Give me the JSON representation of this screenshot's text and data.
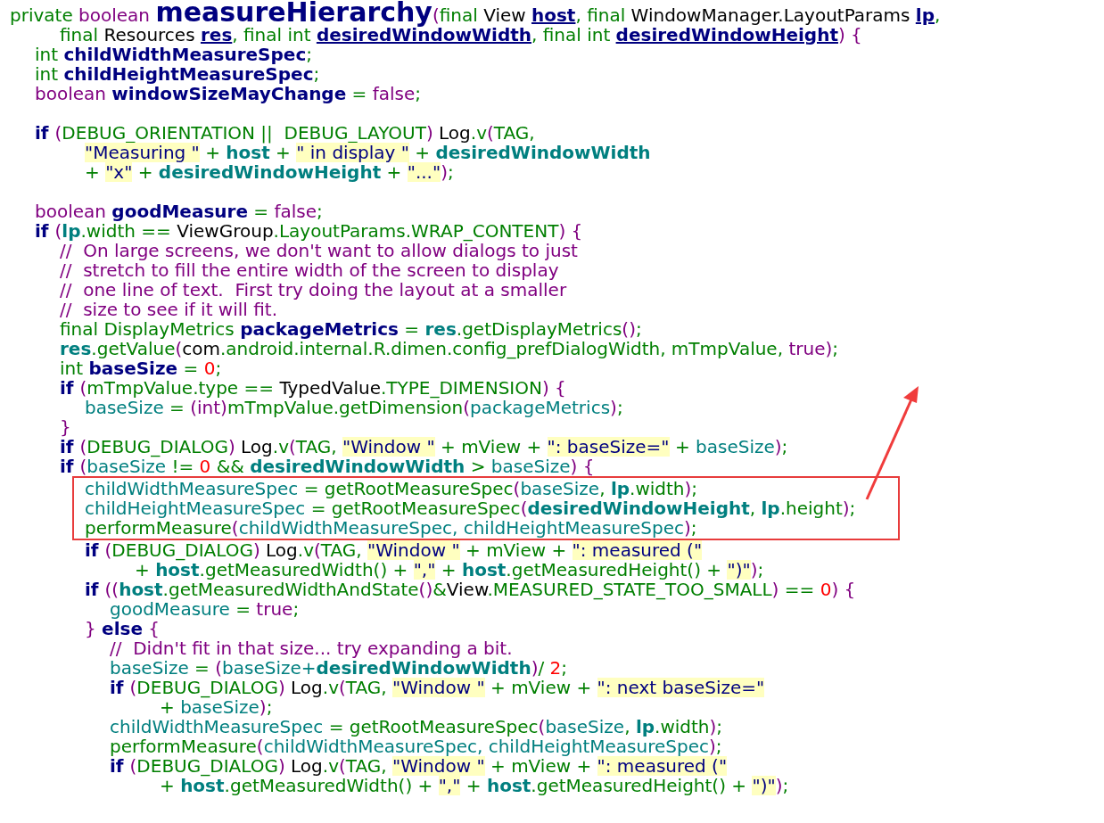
{
  "code_lines": [
    {
      "kind": "code",
      "tokens": [
        {
          "text": "private ",
          "kind": "plain"
        },
        {
          "text": "boolean ",
          "kind": "kw"
        },
        {
          "text": "measureHierarchy",
          "kind": "fn"
        },
        {
          "text": "(",
          "kind": "kw"
        },
        {
          "text": "final ",
          "kind": "plain"
        },
        {
          "text": "View ",
          "kind": "type"
        },
        {
          "text": "host",
          "kind": "param"
        },
        {
          "text": ", final ",
          "kind": "plain"
        },
        {
          "text": "WindowManager.LayoutParams ",
          "kind": "type"
        },
        {
          "text": "lp",
          "kind": "param"
        },
        {
          "text": ",",
          "kind": "plain"
        }
      ],
      "children": [
        {
          "kind": "group",
          "children": [
            {
              "kind": "code",
              "tokens": [
                {
                  "text": "final ",
                  "kind": "plain"
                },
                {
                  "text": "Resources ",
                  "kind": "type"
                },
                {
                  "text": "res",
                  "kind": "param"
                },
                {
                  "text": ", final int ",
                  "kind": "plain"
                },
                {
                  "text": "desiredWindowWidth",
                  "kind": "param"
                },
                {
                  "text": ", final int ",
                  "kind": "plain"
                },
                {
                  "text": "desiredWindowHeight",
                  "kind": "param"
                },
                {
                  "text": ") {",
                  "kind": "kw"
                }
              ]
            }
          ]
        },
        {
          "kind": "code",
          "tokens": [
            {
              "text": "int ",
              "kind": "plain"
            },
            {
              "text": "childWidthMeasureSpec",
              "kind": "decl"
            },
            {
              "text": ";",
              "kind": "plain"
            }
          ]
        },
        {
          "kind": "code",
          "tokens": [
            {
              "text": "int ",
              "kind": "plain"
            },
            {
              "text": "childHeightMeasureSpec",
              "kind": "decl"
            },
            {
              "text": ";",
              "kind": "plain"
            }
          ]
        },
        {
          "kind": "code",
          "tokens": [
            {
              "text": "boolean ",
              "kind": "kw"
            },
            {
              "text": "windowSizeMayChange",
              "kind": "decl"
            },
            {
              "text": " = ",
              "kind": "plain"
            },
            {
              "text": "false",
              "kind": "kw"
            },
            {
              "text": ";",
              "kind": "plain"
            }
          ]
        },
        {
          "kind": "blank"
        },
        {
          "kind": "code",
          "tokens": [
            {
              "text": "if ",
              "kind": "ctl"
            },
            {
              "text": "(",
              "kind": "kw"
            },
            {
              "text": "DEBUG_ORIENTATION ||  DEBUG_LAYOUT",
              "kind": "plain"
            },
            {
              "text": ")",
              "kind": "kw"
            },
            {
              "text": " Log",
              "kind": "type"
            },
            {
              "text": ".v",
              "kind": "plain"
            },
            {
              "text": "(",
              "kind": "kw"
            },
            {
              "text": "TAG,",
              "kind": "plain"
            }
          ],
          "children": [
            {
              "kind": "group",
              "children": [
                {
                  "kind": "code",
                  "tokens": [
                    {
                      "text": "\"Measuring \"",
                      "kind": "str"
                    },
                    {
                      "text": " + ",
                      "kind": "plain"
                    },
                    {
                      "text": "host",
                      "kind": "varb"
                    },
                    {
                      "text": " + ",
                      "kind": "plain"
                    },
                    {
                      "text": "\" in display \"",
                      "kind": "str"
                    },
                    {
                      "text": " + ",
                      "kind": "plain"
                    },
                    {
                      "text": "desiredWindowWidth",
                      "kind": "varb"
                    }
                  ]
                },
                {
                  "kind": "code",
                  "tokens": [
                    {
                      "text": "+ ",
                      "kind": "plain"
                    },
                    {
                      "text": "\"x\"",
                      "kind": "str"
                    },
                    {
                      "text": " + ",
                      "kind": "plain"
                    },
                    {
                      "text": "desiredWindowHeight",
                      "kind": "varb"
                    },
                    {
                      "text": " + ",
                      "kind": "plain"
                    },
                    {
                      "text": "\"...\"",
                      "kind": "str"
                    },
                    {
                      "text": ")",
                      "kind": "kw"
                    },
                    {
                      "text": ";",
                      "kind": "plain"
                    }
                  ]
                }
              ]
            }
          ]
        },
        {
          "kind": "blank"
        },
        {
          "kind": "code",
          "tokens": [
            {
              "text": "boolean ",
              "kind": "kw"
            },
            {
              "text": "goodMeasure",
              "kind": "decl"
            },
            {
              "text": " = ",
              "kind": "plain"
            },
            {
              "text": "false",
              "kind": "kw"
            },
            {
              "text": ";",
              "kind": "plain"
            }
          ]
        },
        {
          "kind": "code",
          "tokens": [
            {
              "text": "if ",
              "kind": "ctl"
            },
            {
              "text": "(",
              "kind": "kw"
            },
            {
              "text": "lp",
              "kind": "varb"
            },
            {
              "text": ".width == ",
              "kind": "plain"
            },
            {
              "text": "ViewGroup",
              "kind": "type"
            },
            {
              "text": ".LayoutParams.WRAP_CONTENT",
              "kind": "plain"
            },
            {
              "text": ") {",
              "kind": "kw"
            }
          ],
          "children": [
            {
              "kind": "code",
              "tokens": [
                {
                  "text": "//  On large screens, we don't want to allow dialogs to just",
                  "kind": "cmt"
                }
              ]
            },
            {
              "kind": "code",
              "tokens": [
                {
                  "text": "//  stretch to fill the entire width of the screen to display",
                  "kind": "cmt"
                }
              ]
            },
            {
              "kind": "code",
              "tokens": [
                {
                  "text": "//  one line of text.  First try doing the layout at a smaller",
                  "kind": "cmt"
                }
              ]
            },
            {
              "kind": "code",
              "tokens": [
                {
                  "text": "//  size to see if it will fit.",
                  "kind": "cmt"
                }
              ]
            },
            {
              "kind": "code",
              "tokens": [
                {
                  "text": "final DisplayMetrics ",
                  "kind": "plain"
                },
                {
                  "text": "packageMetrics",
                  "kind": "decl"
                },
                {
                  "text": " = ",
                  "kind": "plain"
                },
                {
                  "text": "res",
                  "kind": "varb"
                },
                {
                  "text": ".getDisplayMetrics",
                  "kind": "plain"
                },
                {
                  "text": "()",
                  "kind": "kw"
                },
                {
                  "text": ";",
                  "kind": "plain"
                }
              ]
            },
            {
              "kind": "code",
              "tokens": [
                {
                  "text": "res",
                  "kind": "varb"
                },
                {
                  "text": ".getValue",
                  "kind": "plain"
                },
                {
                  "text": "(",
                  "kind": "kw"
                },
                {
                  "text": "com",
                  "kind": "type"
                },
                {
                  "text": ".android.internal.R.dimen.config_prefDialogWidth, mTmpValue, ",
                  "kind": "plain"
                },
                {
                  "text": "true)",
                  "kind": "kw"
                },
                {
                  "text": ";",
                  "kind": "plain"
                }
              ]
            },
            {
              "kind": "code",
              "tokens": [
                {
                  "text": "int ",
                  "kind": "plain"
                },
                {
                  "text": "baseSize",
                  "kind": "decl"
                },
                {
                  "text": " = ",
                  "kind": "plain"
                },
                {
                  "text": "0",
                  "kind": "num"
                },
                {
                  "text": ";",
                  "kind": "plain"
                }
              ]
            },
            {
              "kind": "code",
              "tokens": [
                {
                  "text": "if ",
                  "kind": "ctl"
                },
                {
                  "text": "(",
                  "kind": "kw"
                },
                {
                  "text": "mTmpValue.type == ",
                  "kind": "plain"
                },
                {
                  "text": "TypedValue",
                  "kind": "type"
                },
                {
                  "text": ".TYPE_DIMENSION",
                  "kind": "plain"
                },
                {
                  "text": ") {",
                  "kind": "kw"
                }
              ],
              "children": [
                {
                  "kind": "code",
                  "tokens": [
                    {
                      "text": "baseSize",
                      "kind": "var"
                    },
                    {
                      "text": " = ",
                      "kind": "plain"
                    },
                    {
                      "text": "(int)",
                      "kind": "kw"
                    },
                    {
                      "text": "mTmpValue.getDimension",
                      "kind": "plain"
                    },
                    {
                      "text": "(",
                      "kind": "kw"
                    },
                    {
                      "text": "packageMetrics",
                      "kind": "var"
                    },
                    {
                      "text": ")",
                      "kind": "kw"
                    },
                    {
                      "text": ";",
                      "kind": "plain"
                    }
                  ]
                }
              ]
            },
            {
              "kind": "code",
              "tokens": [
                {
                  "text": "}",
                  "kind": "kw"
                }
              ]
            },
            {
              "kind": "code",
              "tokens": [
                {
                  "text": "if ",
                  "kind": "ctl"
                },
                {
                  "text": "(",
                  "kind": "kw"
                },
                {
                  "text": "DEBUG_DIALOG",
                  "kind": "plain"
                },
                {
                  "text": ")",
                  "kind": "kw"
                },
                {
                  "text": " Log",
                  "kind": "type"
                },
                {
                  "text": ".v",
                  "kind": "plain"
                },
                {
                  "text": "(",
                  "kind": "kw"
                },
                {
                  "text": "TAG, ",
                  "kind": "plain"
                },
                {
                  "text": "\"Window \"",
                  "kind": "str"
                },
                {
                  "text": " + mView + ",
                  "kind": "plain"
                },
                {
                  "text": "\": baseSize=\"",
                  "kind": "str"
                },
                {
                  "text": " + ",
                  "kind": "plain"
                },
                {
                  "text": "baseSize",
                  "kind": "var"
                },
                {
                  "text": ")",
                  "kind": "kw"
                },
                {
                  "text": ";",
                  "kind": "plain"
                }
              ]
            },
            {
              "kind": "code",
              "tokens": [
                {
                  "text": "if ",
                  "kind": "ctl"
                },
                {
                  "text": "(",
                  "kind": "kw"
                },
                {
                  "text": "baseSize",
                  "kind": "var"
                },
                {
                  "text": " != ",
                  "kind": "plain"
                },
                {
                  "text": "0",
                  "kind": "num"
                },
                {
                  "text": " && ",
                  "kind": "plain"
                },
                {
                  "text": "desiredWindowWidth",
                  "kind": "varb"
                },
                {
                  "text": " > ",
                  "kind": "plain"
                },
                {
                  "text": "baseSize",
                  "kind": "var"
                },
                {
                  "text": ") {",
                  "kind": "kw"
                }
              ],
              "children": [
                {
                  "kind": "boxed",
                  "children": [
                    {
                      "kind": "code",
                      "tokens": [
                        {
                          "text": "childWidthMeasureSpec",
                          "kind": "var"
                        },
                        {
                          "text": " = getRootMeasureSpec",
                          "kind": "plain"
                        },
                        {
                          "text": "(",
                          "kind": "kw"
                        },
                        {
                          "text": "baseSize",
                          "kind": "var"
                        },
                        {
                          "text": ", ",
                          "kind": "plain"
                        },
                        {
                          "text": "lp",
                          "kind": "varb"
                        },
                        {
                          "text": ".width",
                          "kind": "plain"
                        },
                        {
                          "text": ")",
                          "kind": "kw"
                        },
                        {
                          "text": ";",
                          "kind": "plain"
                        }
                      ]
                    },
                    {
                      "kind": "code",
                      "tokens": [
                        {
                          "text": "childHeightMeasureSpec",
                          "kind": "var"
                        },
                        {
                          "text": " = getRootMeasureSpec",
                          "kind": "plain"
                        },
                        {
                          "text": "(",
                          "kind": "kw"
                        },
                        {
                          "text": "desiredWindowHeight",
                          "kind": "varb"
                        },
                        {
                          "text": ", ",
                          "kind": "plain"
                        },
                        {
                          "text": "lp",
                          "kind": "varb"
                        },
                        {
                          "text": ".height",
                          "kind": "plain"
                        },
                        {
                          "text": ")",
                          "kind": "kw"
                        },
                        {
                          "text": ";",
                          "kind": "plain"
                        }
                      ]
                    },
                    {
                      "kind": "code",
                      "tokens": [
                        {
                          "text": "performMeasure",
                          "kind": "plain"
                        },
                        {
                          "text": "(",
                          "kind": "kw"
                        },
                        {
                          "text": "childWidthMeasureSpec, childHeightMeasureSpec",
                          "kind": "var"
                        },
                        {
                          "text": ")",
                          "kind": "kw"
                        },
                        {
                          "text": ";",
                          "kind": "plain"
                        }
                      ]
                    }
                  ]
                },
                {
                  "kind": "code",
                  "tokens": [
                    {
                      "text": "if ",
                      "kind": "ctl"
                    },
                    {
                      "text": "(",
                      "kind": "kw"
                    },
                    {
                      "text": "DEBUG_DIALOG",
                      "kind": "plain"
                    },
                    {
                      "text": ")",
                      "kind": "kw"
                    },
                    {
                      "text": " Log",
                      "kind": "type"
                    },
                    {
                      "text": ".v",
                      "kind": "plain"
                    },
                    {
                      "text": "(",
                      "kind": "kw"
                    },
                    {
                      "text": "TAG, ",
                      "kind": "plain"
                    },
                    {
                      "text": "\"Window \"",
                      "kind": "str"
                    },
                    {
                      "text": " + mView + ",
                      "kind": "plain"
                    },
                    {
                      "text": "\": measured (\"",
                      "kind": "str"
                    }
                  ],
                  "children": [
                    {
                      "kind": "group",
                      "children": [
                        {
                          "kind": "code",
                          "tokens": [
                            {
                              "text": "+ ",
                              "kind": "plain"
                            },
                            {
                              "text": "host",
                              "kind": "varb"
                            },
                            {
                              "text": ".getMeasuredWidth() + ",
                              "kind": "plain"
                            },
                            {
                              "text": "\",\"",
                              "kind": "str"
                            },
                            {
                              "text": " + ",
                              "kind": "plain"
                            },
                            {
                              "text": "host",
                              "kind": "varb"
                            },
                            {
                              "text": ".getMeasuredHeight() + ",
                              "kind": "plain"
                            },
                            {
                              "text": "\")\"",
                              "kind": "str"
                            },
                            {
                              "text": ")",
                              "kind": "kw"
                            },
                            {
                              "text": ";",
                              "kind": "plain"
                            }
                          ]
                        }
                      ]
                    }
                  ]
                },
                {
                  "kind": "code",
                  "tokens": [
                    {
                      "text": "if ",
                      "kind": "ctl"
                    },
                    {
                      "text": "((",
                      "kind": "kw"
                    },
                    {
                      "text": "host",
                      "kind": "varb"
                    },
                    {
                      "text": ".getMeasuredWidthAndState",
                      "kind": "plain"
                    },
                    {
                      "text": "()",
                      "kind": "kw"
                    },
                    {
                      "text": "&",
                      "kind": "plain"
                    },
                    {
                      "text": "View",
                      "kind": "type"
                    },
                    {
                      "text": ".MEASURED_STATE_TOO_SMALL",
                      "kind": "plain"
                    },
                    {
                      "text": ")",
                      "kind": "kw"
                    },
                    {
                      "text": " == ",
                      "kind": "plain"
                    },
                    {
                      "text": "0",
                      "kind": "num"
                    },
                    {
                      "text": ") {",
                      "kind": "kw"
                    }
                  ],
                  "children": [
                    {
                      "kind": "code",
                      "tokens": [
                        {
                          "text": "goodMeasure",
                          "kind": "var"
                        },
                        {
                          "text": " = ",
                          "kind": "plain"
                        },
                        {
                          "text": "true",
                          "kind": "kw"
                        },
                        {
                          "text": ";",
                          "kind": "plain"
                        }
                      ]
                    }
                  ]
                },
                {
                  "kind": "code",
                  "tokens": [
                    {
                      "text": "} ",
                      "kind": "kw"
                    },
                    {
                      "text": "else",
                      "kind": "ctl"
                    },
                    {
                      "text": " {",
                      "kind": "kw"
                    }
                  ],
                  "children": [
                    {
                      "kind": "code",
                      "tokens": [
                        {
                          "text": "//  Didn't fit in that size... try expanding a bit.",
                          "kind": "cmt"
                        }
                      ]
                    },
                    {
                      "kind": "code",
                      "tokens": [
                        {
                          "text": "baseSize",
                          "kind": "var"
                        },
                        {
                          "text": " = ",
                          "kind": "plain"
                        },
                        {
                          "text": "(",
                          "kind": "kw"
                        },
                        {
                          "text": "baseSize+",
                          "kind": "var"
                        },
                        {
                          "text": "desiredWindowWidth",
                          "kind": "varb"
                        },
                        {
                          "text": ")",
                          "kind": "kw"
                        },
                        {
                          "text": "/ ",
                          "kind": "plain"
                        },
                        {
                          "text": "2",
                          "kind": "num"
                        },
                        {
                          "text": ";",
                          "kind": "plain"
                        }
                      ]
                    },
                    {
                      "kind": "code",
                      "tokens": [
                        {
                          "text": "if ",
                          "kind": "ctl"
                        },
                        {
                          "text": "(",
                          "kind": "kw"
                        },
                        {
                          "text": "DEBUG_DIALOG",
                          "kind": "plain"
                        },
                        {
                          "text": ")",
                          "kind": "kw"
                        },
                        {
                          "text": " Log",
                          "kind": "type"
                        },
                        {
                          "text": ".v",
                          "kind": "plain"
                        },
                        {
                          "text": "(",
                          "kind": "kw"
                        },
                        {
                          "text": "TAG, ",
                          "kind": "plain"
                        },
                        {
                          "text": "\"Window \"",
                          "kind": "str"
                        },
                        {
                          "text": " + mView + ",
                          "kind": "plain"
                        },
                        {
                          "text": "\": next baseSize=\"",
                          "kind": "str"
                        }
                      ],
                      "children": [
                        {
                          "kind": "group",
                          "children": [
                            {
                              "kind": "code",
                              "tokens": [
                                {
                                  "text": "+ ",
                                  "kind": "plain"
                                },
                                {
                                  "text": "baseSize",
                                  "kind": "var"
                                },
                                {
                                  "text": ")",
                                  "kind": "kw"
                                },
                                {
                                  "text": ";",
                                  "kind": "plain"
                                }
                              ]
                            }
                          ]
                        }
                      ]
                    },
                    {
                      "kind": "code",
                      "tokens": [
                        {
                          "text": "childWidthMeasureSpec",
                          "kind": "var"
                        },
                        {
                          "text": " = getRootMeasureSpec",
                          "kind": "plain"
                        },
                        {
                          "text": "(",
                          "kind": "kw"
                        },
                        {
                          "text": "baseSize",
                          "kind": "var"
                        },
                        {
                          "text": ", ",
                          "kind": "plain"
                        },
                        {
                          "text": "lp",
                          "kind": "varb"
                        },
                        {
                          "text": ".width",
                          "kind": "plain"
                        },
                        {
                          "text": ")",
                          "kind": "kw"
                        },
                        {
                          "text": ";",
                          "kind": "plain"
                        }
                      ]
                    },
                    {
                      "kind": "code",
                      "tokens": [
                        {
                          "text": "performMeasure",
                          "kind": "plain"
                        },
                        {
                          "text": "(",
                          "kind": "kw"
                        },
                        {
                          "text": "childWidthMeasureSpec, childHeightMeasureSpec",
                          "kind": "var"
                        },
                        {
                          "text": ")",
                          "kind": "kw"
                        },
                        {
                          "text": ";",
                          "kind": "plain"
                        }
                      ]
                    },
                    {
                      "kind": "code",
                      "tokens": [
                        {
                          "text": "if ",
                          "kind": "ctl"
                        },
                        {
                          "text": "(",
                          "kind": "kw"
                        },
                        {
                          "text": "DEBUG_DIALOG",
                          "kind": "plain"
                        },
                        {
                          "text": ")",
                          "kind": "kw"
                        },
                        {
                          "text": " Log",
                          "kind": "type"
                        },
                        {
                          "text": ".v",
                          "kind": "plain"
                        },
                        {
                          "text": "(",
                          "kind": "kw"
                        },
                        {
                          "text": "TAG, ",
                          "kind": "plain"
                        },
                        {
                          "text": "\"Window \"",
                          "kind": "str"
                        },
                        {
                          "text": " + mView + ",
                          "kind": "plain"
                        },
                        {
                          "text": "\": measured (\"",
                          "kind": "str"
                        }
                      ],
                      "children": [
                        {
                          "kind": "group",
                          "children": [
                            {
                              "kind": "code",
                              "tokens": [
                                {
                                  "text": "+ ",
                                  "kind": "plain"
                                },
                                {
                                  "text": "host",
                                  "kind": "varb"
                                },
                                {
                                  "text": ".getMeasuredWidth() + ",
                                  "kind": "plain"
                                },
                                {
                                  "text": "\",\"",
                                  "kind": "str"
                                },
                                {
                                  "text": " + ",
                                  "kind": "plain"
                                },
                                {
                                  "text": "host",
                                  "kind": "varb"
                                },
                                {
                                  "text": ".getMeasuredHeight() + ",
                                  "kind": "plain"
                                },
                                {
                                  "text": "\")\"",
                                  "kind": "str"
                                },
                                {
                                  "text": ")",
                                  "kind": "kw"
                                },
                                {
                                  "text": ";",
                                  "kind": "plain"
                                }
                              ]
                            }
                          ]
                        }
                      ]
                    }
                  ]
                }
              ]
            }
          ]
        }
      ]
    }
  ]
}
